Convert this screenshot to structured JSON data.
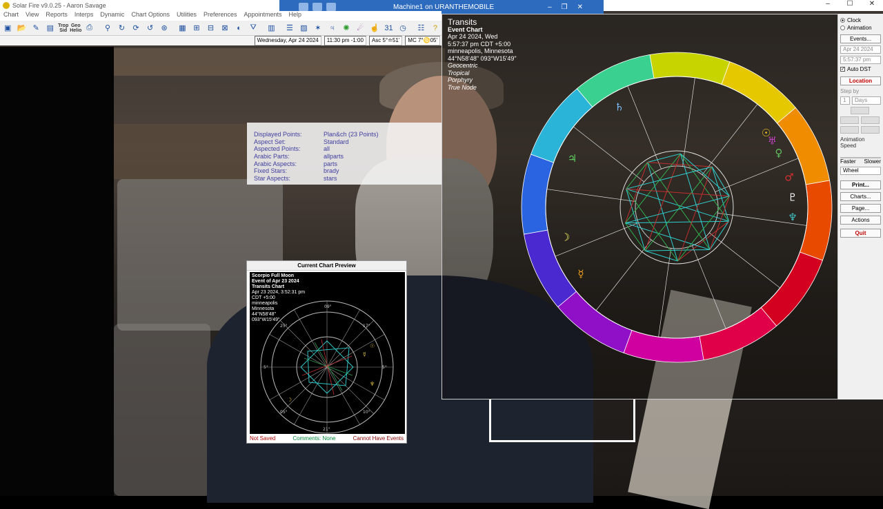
{
  "window": {
    "app_title": "Solar Fire v9.0.25  -  Aaron Savage",
    "controls": [
      "–",
      "☐",
      "✕"
    ]
  },
  "remote": {
    "title": "Machine1 on URANTHEMOBILE",
    "controls": [
      "–",
      "❐",
      "✕"
    ]
  },
  "menu": [
    "Chart",
    "View",
    "Reports",
    "Interps",
    "Dynamic",
    "Chart Options",
    "Utilities",
    "Preferences",
    "Appointments",
    "Help"
  ],
  "toolbar": {
    "trop_sid": [
      "Trop",
      "Sid"
    ],
    "geo_helio": [
      "Geo",
      "Helio"
    ]
  },
  "status": {
    "date": "Wednesday, Apr 24 2024",
    "time": "11:30 pm  -1:00",
    "asc": "Asc 5°≏51'",
    "mc": "MC 7°♋05'"
  },
  "settings": [
    {
      "label": "Displayed Points:",
      "value": "Plan&ch  (23 Points)"
    },
    {
      "label": "Aspect Set:",
      "value": "Standard"
    },
    {
      "label": "Aspected Points:",
      "value": "all"
    },
    {
      "label": "Arabic Parts:",
      "value": "allparts"
    },
    {
      "label": "Arabic Aspects:",
      "value": "parts"
    },
    {
      "label": "Fixed Stars:",
      "value": "brady"
    },
    {
      "label": "Star Aspects:",
      "value": "stars"
    }
  ],
  "preview": {
    "title": "Current Chart Preview",
    "name": "Scorpio Full Moon",
    "event": "Event of Apr 23 2024",
    "type": "Transits Chart",
    "datetime": "Apr 23 2024, 3:52:31 pm",
    "tz": "CDT +5:00",
    "city": "minneapolis",
    "state": "Minnesota",
    "lat": "44°N58'48\"",
    "lon": "093°W15'49\"",
    "status_saved": "Not Saved",
    "status_comments": "Comments: None",
    "status_events": "Cannot Have Events"
  },
  "chart": {
    "title": "Transits",
    "subtitle": "Event Chart",
    "date": "Apr 24 2024, Wed",
    "time": "5:57:37 pm  CDT +5:00",
    "place": "minneapolis, Minnesota",
    "coords": "44°N58'48\" 093°W15'49\"",
    "system": "Geocentric",
    "zodiac": "Tropical",
    "houses": "Porphyry",
    "node": "True Node"
  },
  "panel": {
    "mode_clock": "Clock",
    "mode_animation": "Animation",
    "events_btn": "Events...",
    "date_field": "Apr 24 2024",
    "time_field": "5:57:37 pm",
    "auto_dst": "Auto DST",
    "location_btn": "Location",
    "step_by": "Step by",
    "step_value": "1",
    "step_unit": "Days",
    "anim_speed": "Animation Speed",
    "faster": "Faster",
    "slower": "Slower",
    "wheel": "Wheel",
    "print_btn": "Print...",
    "charts_btn": "Charts...",
    "page_btn": "Page...",
    "actions_btn": "Actions",
    "quit_btn": "Quit"
  }
}
